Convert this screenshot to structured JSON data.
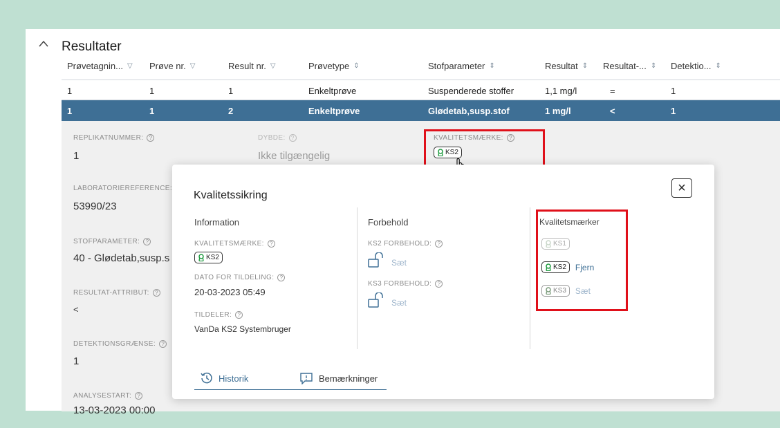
{
  "section": {
    "title": "Resultater"
  },
  "table": {
    "headers": [
      "Prøvetagnin...",
      "Prøve nr.",
      "Result nr.",
      "Prøvetype",
      "Stofparameter",
      "Resultat",
      "Resultat-...",
      "Detektio..."
    ],
    "rows": [
      [
        "1",
        "1",
        "1",
        "Enkeltprøve",
        "Suspenderede stoffer",
        "1,1 mg/l",
        "=",
        "1"
      ],
      [
        "1",
        "1",
        "2",
        "Enkeltprøve",
        "Glødetab,susp.stof",
        "1 mg/l",
        "<",
        "1"
      ]
    ]
  },
  "details": {
    "replikat_label": "REPLIKATNUMMER:",
    "replikat_value": "1",
    "dybde_label": "DYBDE:",
    "dybde_value": "Ikke tilgængelig",
    "kvalitet_label": "KVALITETSMÆRKE:",
    "kvalitet_badge": "KS2",
    "lab_label": "LABORATORIEREFERENCE:",
    "lab_value": "53990/23",
    "stof_label": "STOFPARAMETER:",
    "stof_value": "40 - Glødetab,susp.s",
    "attr_label": "RESULTAT-ATTRIBUT:",
    "attr_value": "<",
    "detek_label": "DETEKTIONSGRÆNSE:",
    "detek_value": "1",
    "analyse_label": "ANALYSESTART:",
    "analyse_value": "13-03-2023 00:00"
  },
  "modal": {
    "title": "Kvalitetssikring",
    "close": "×",
    "info_header": "Information",
    "forbehold_header": "Forbehold",
    "km_header": "Kvalitetsmærker",
    "km_label": "KVALITETSMÆRKE:",
    "km_badge": "KS2",
    "dato_label": "DATO FOR TILDELING:",
    "dato_value": "20-03-2023 05:49",
    "tildeler_label": "TILDELER:",
    "tildeler_value": "VanDa KS2 Systembruger",
    "ks2_forbehold_label": "KS2 FORBEHOLD:",
    "ks3_forbehold_label": "KS3 FORBEHOLD:",
    "saet": "Sæt",
    "marks": [
      {
        "badge": "KS1",
        "action": ""
      },
      {
        "badge": "KS2",
        "action": "Fjern"
      },
      {
        "badge": "KS3",
        "action": "Sæt"
      }
    ],
    "tabs": {
      "historik": "Historik",
      "bemaerkninger": "Bemærkninger"
    }
  },
  "colors": {
    "accent": "#3e6f95",
    "badge_green": "#1d9a3e",
    "highlight": "#e0101a",
    "background": "#bfe0d2"
  }
}
